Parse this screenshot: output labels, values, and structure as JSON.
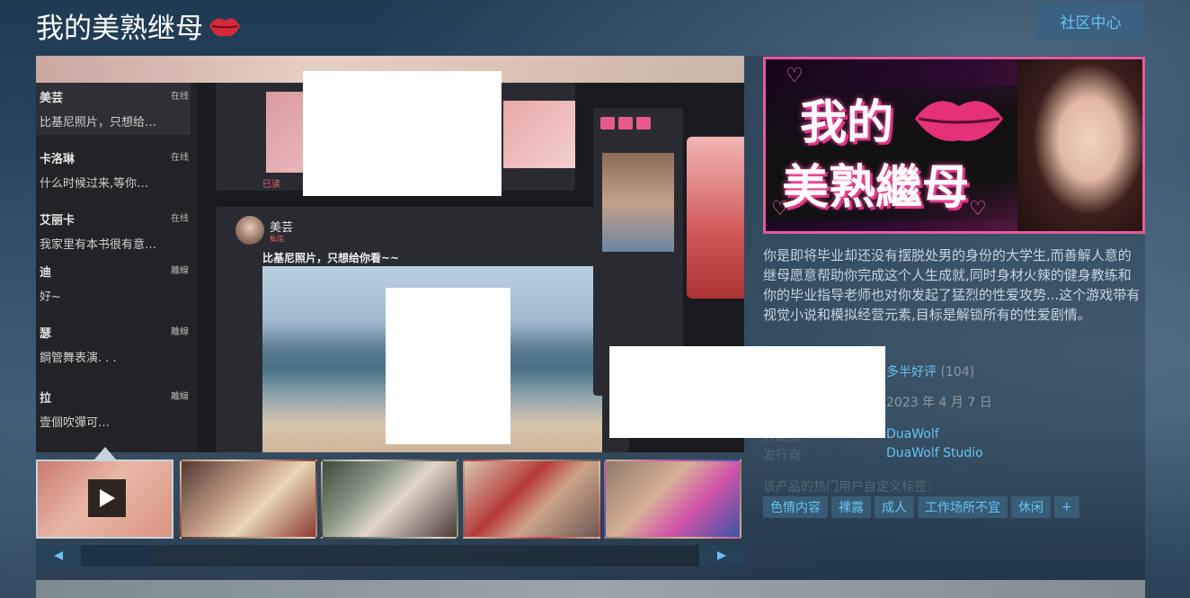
{
  "header": {
    "title": "我的美熟继母",
    "community_button": "社区中心"
  },
  "media": {
    "chat_list": [
      {
        "name": "美芸",
        "status": "在线",
        "message": "比基尼照片，只想给…"
      },
      {
        "name": "卡洛琳",
        "status": "在线",
        "message": "什么时候过来,等你…"
      },
      {
        "name": "艾丽卡",
        "status": "在线",
        "message": "我家里有本书很有意…"
      },
      {
        "name": "迪",
        "status": "離線",
        "message": "好~"
      },
      {
        "name": "瑟",
        "status": "離線",
        "message": "鋼管舞表演. . ."
      },
      {
        "name": "拉",
        "status": "離線",
        "message": "壹個吹彈可…"
      }
    ],
    "post": {
      "name": "美芸",
      "tag": "私信",
      "text": "比基尼照片，只想给你看~~"
    },
    "sent_label": "已读"
  },
  "thumbnails": [
    {
      "kind": "video",
      "active": true
    },
    {
      "kind": "screenshot",
      "active": false
    },
    {
      "kind": "screenshot",
      "active": false
    },
    {
      "kind": "screenshot",
      "active": false
    },
    {
      "kind": "screenshot",
      "active": false
    }
  ],
  "capsule": {
    "line1": "我的",
    "line2": "美熟繼母"
  },
  "description": "你是即将毕业却还没有摆脱处男的身份的大学生,而善解人意的继母愿意帮助你完成这个人生成就,同时身材火辣的健身教练和你的毕业指导老师也对你发起了猛烈的性爱攻势...这个游戏带有视觉小说和模拟经营元素,目标是解锁所有的性爱剧情。",
  "info": {
    "review_summary": "多半好评",
    "review_count": "(104)",
    "release_date": "2023 年 4 月 7 日",
    "developer_label": "开发商:",
    "developer": "DuaWolf",
    "publisher_label": "发行商:",
    "publisher": "DuaWolf Studio"
  },
  "tags_label": "该产品的热门用户自定义标签:",
  "tags": [
    "色情内容",
    "裸露",
    "成人",
    "工作场所不宜",
    "休闲",
    "+"
  ],
  "colors": {
    "accent": "#67c1f5",
    "text": "#c6d4df",
    "capsule_border": "#e55aa0"
  }
}
